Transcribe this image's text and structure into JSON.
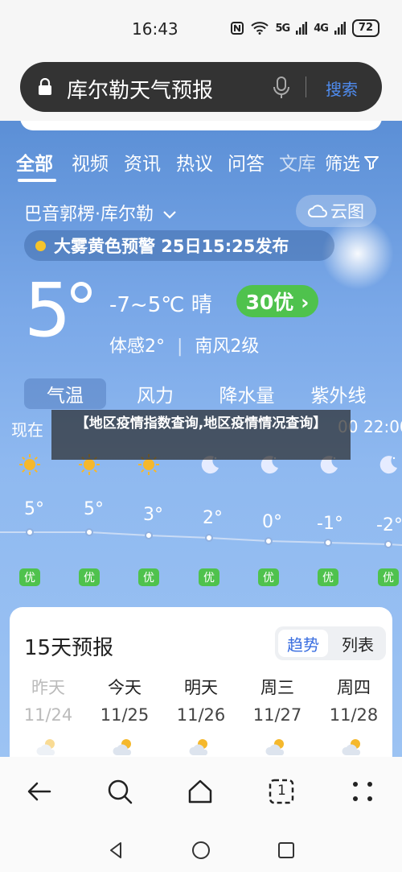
{
  "status": {
    "time": "16:43",
    "signal1": "5G",
    "signal2": "4G",
    "battery": "72"
  },
  "search": {
    "query": "库尔勒天气预报",
    "button": "搜索"
  },
  "tabs": [
    {
      "label": "全部",
      "active": true
    },
    {
      "label": "视频"
    },
    {
      "label": "资讯"
    },
    {
      "label": "热议"
    },
    {
      "label": "问答"
    },
    {
      "label": "文库"
    }
  ],
  "filter_label": "筛选",
  "weather": {
    "location": "巴音郭楞·库尔勒",
    "cloud_map": "云图",
    "alert": "大雾黄色预警 25日15:25发布",
    "current_temp": "5",
    "range_condition": "-7~5℃ 晴",
    "aqi": "30优 ›",
    "feels_like": "体感2°",
    "wind": "南风2级",
    "subtabs": [
      "气温",
      "风力",
      "降水量",
      "紫外线"
    ],
    "hourly": [
      {
        "time": "现在",
        "icon": "sun-icon",
        "temp": "5°",
        "aqi": "优"
      },
      {
        "time": "",
        "icon": "sun-icon",
        "temp": "5°",
        "aqi": "优"
      },
      {
        "time": "",
        "icon": "sun-icon",
        "temp": "3°",
        "aqi": "优"
      },
      {
        "time": "",
        "icon": "moon-icon",
        "temp": "2°",
        "aqi": "优"
      },
      {
        "time": "",
        "icon": "moon-icon",
        "temp": "0°",
        "aqi": "优"
      },
      {
        "time": "00",
        "icon": "moon-icon",
        "temp": "-1°",
        "aqi": "优"
      },
      {
        "time": "22:00",
        "icon": "moon-icon",
        "temp": "-2°",
        "aqi": "优"
      }
    ]
  },
  "overlay_text": "【地区疫情指数查询,地区疫情情况查询】",
  "forecast": {
    "title": "15天预报",
    "toggle_active": "趋势",
    "toggle_other": "列表",
    "days": [
      {
        "name": "昨天",
        "date": "11/24",
        "past": true
      },
      {
        "name": "今天",
        "date": "11/25"
      },
      {
        "name": "明天",
        "date": "11/26"
      },
      {
        "name": "周三",
        "date": "11/27"
      },
      {
        "name": "周四",
        "date": "11/28"
      }
    ]
  },
  "nav": {
    "tabs_count": "1"
  },
  "colors": {
    "accent": "#3a6ee0",
    "aqi_green": "#4fc24d",
    "alert_yellow": "#f5c42c"
  }
}
